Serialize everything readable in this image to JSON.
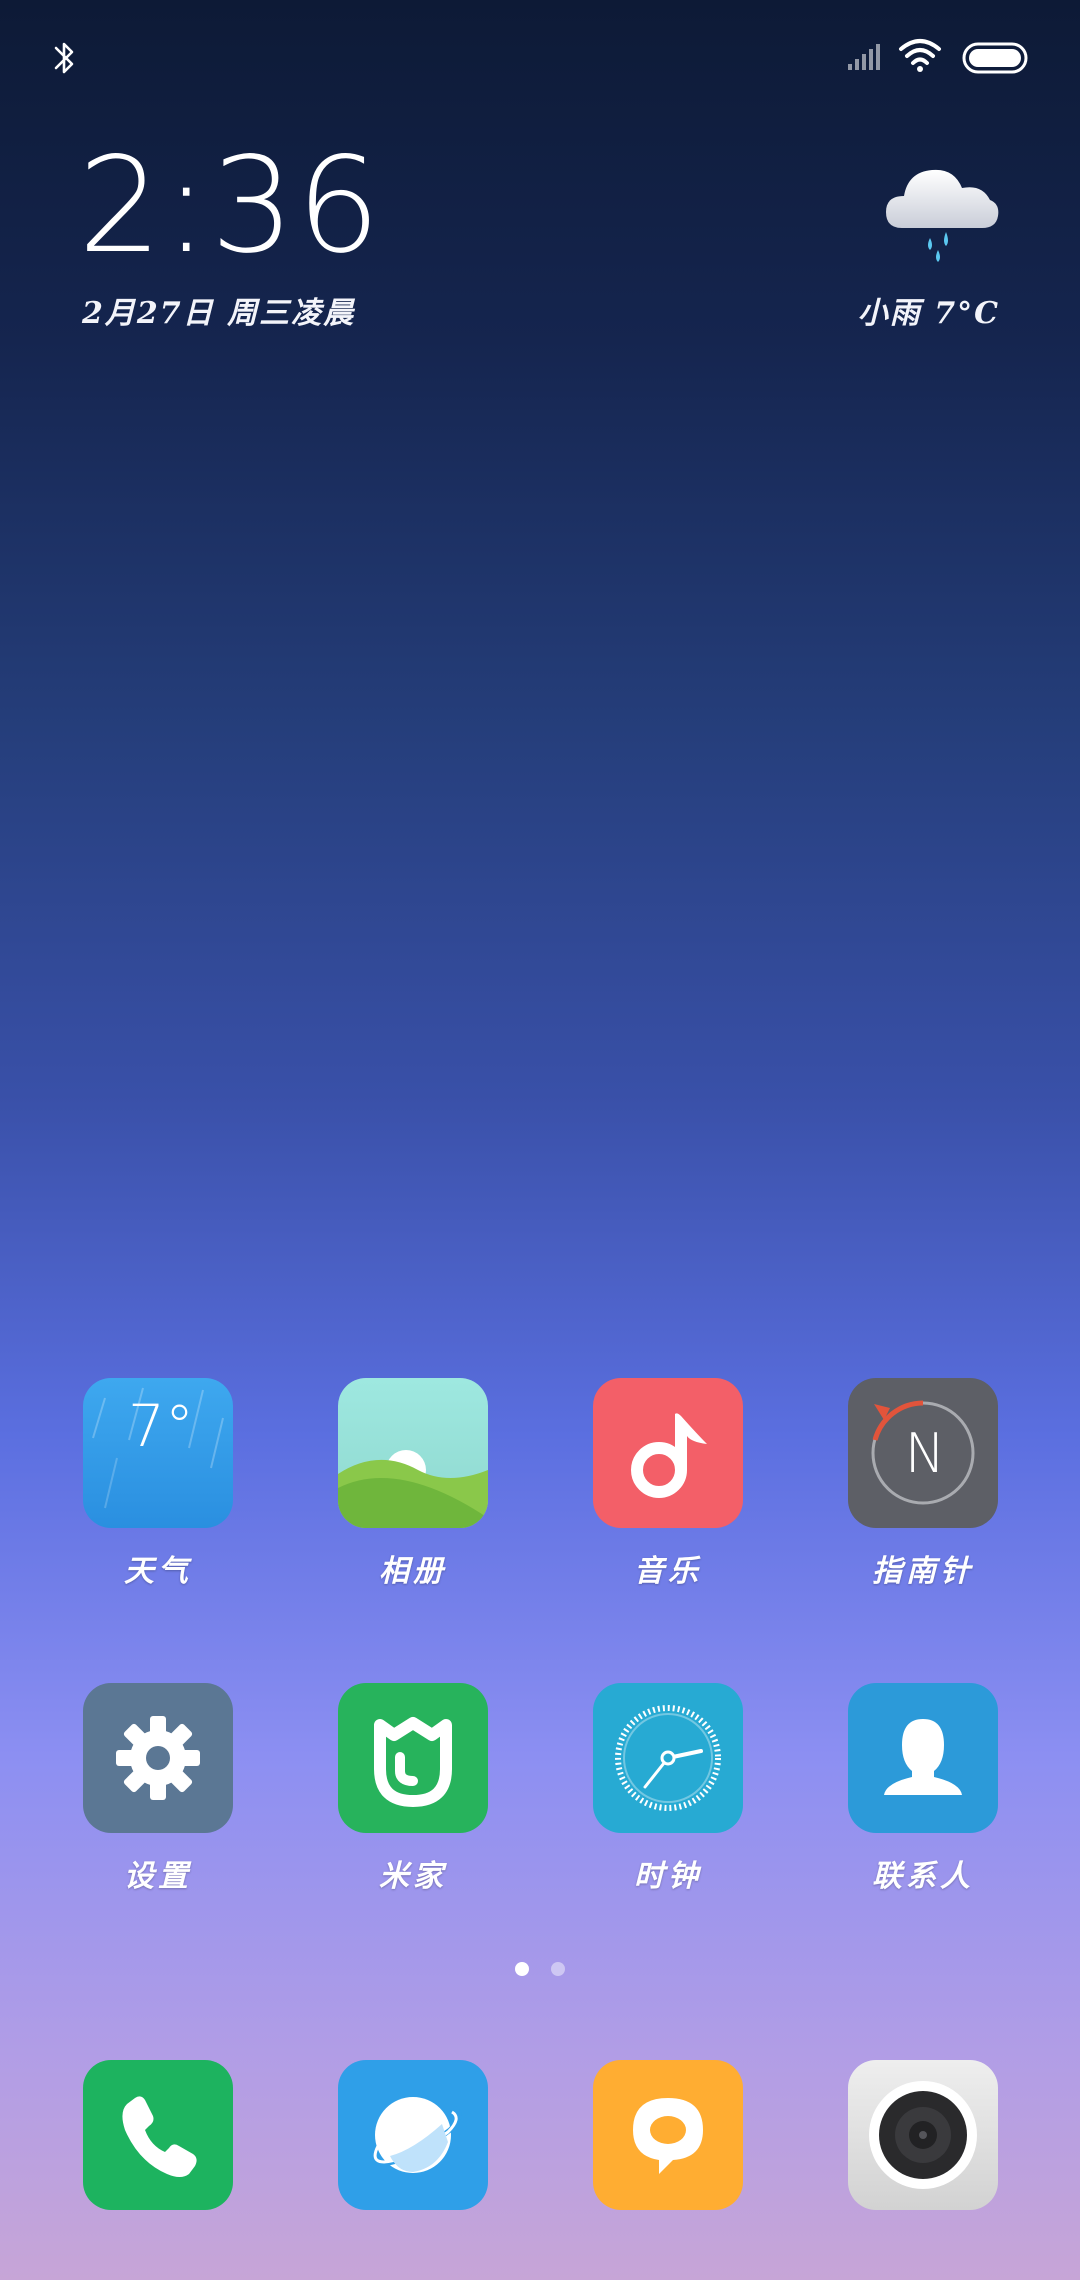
{
  "status_bar": {
    "icons": [
      "bluetooth-icon",
      "signal-icon",
      "wifi-icon",
      "battery-icon"
    ]
  },
  "clock_widget": {
    "time": "2:36",
    "date": "2月27日 周三凌晨",
    "weather": "小雨  7°C",
    "weather_icon": "rain-cloud-icon"
  },
  "apps": [
    {
      "label": "天气",
      "icon": "weather-icon",
      "temp": "7°",
      "color": "#2f9de6"
    },
    {
      "label": "相册",
      "icon": "gallery-icon",
      "color": "#8fd8a0"
    },
    {
      "label": "音乐",
      "icon": "music-icon",
      "color": "#f35f68"
    },
    {
      "label": "指南针",
      "icon": "compass-icon",
      "letter": "N",
      "color": "#5d5f66"
    },
    {
      "label": "设置",
      "icon": "settings-icon",
      "color": "#5b7794"
    },
    {
      "label": "米家",
      "icon": "mijia-icon",
      "color": "#27b35c"
    },
    {
      "label": "时钟",
      "icon": "clock-icon",
      "color": "#27aad3"
    },
    {
      "label": "联系人",
      "icon": "contacts-icon",
      "color": "#2c9ad9"
    }
  ],
  "page_indicator": {
    "pages": 2,
    "active": 1
  },
  "dock": [
    {
      "icon": "phone-icon",
      "color": "#1db35f"
    },
    {
      "icon": "browser-icon",
      "color": "#2f9fe8"
    },
    {
      "icon": "messages-icon",
      "color": "#ffad32"
    },
    {
      "icon": "camera-icon",
      "color": "#dedede"
    }
  ]
}
